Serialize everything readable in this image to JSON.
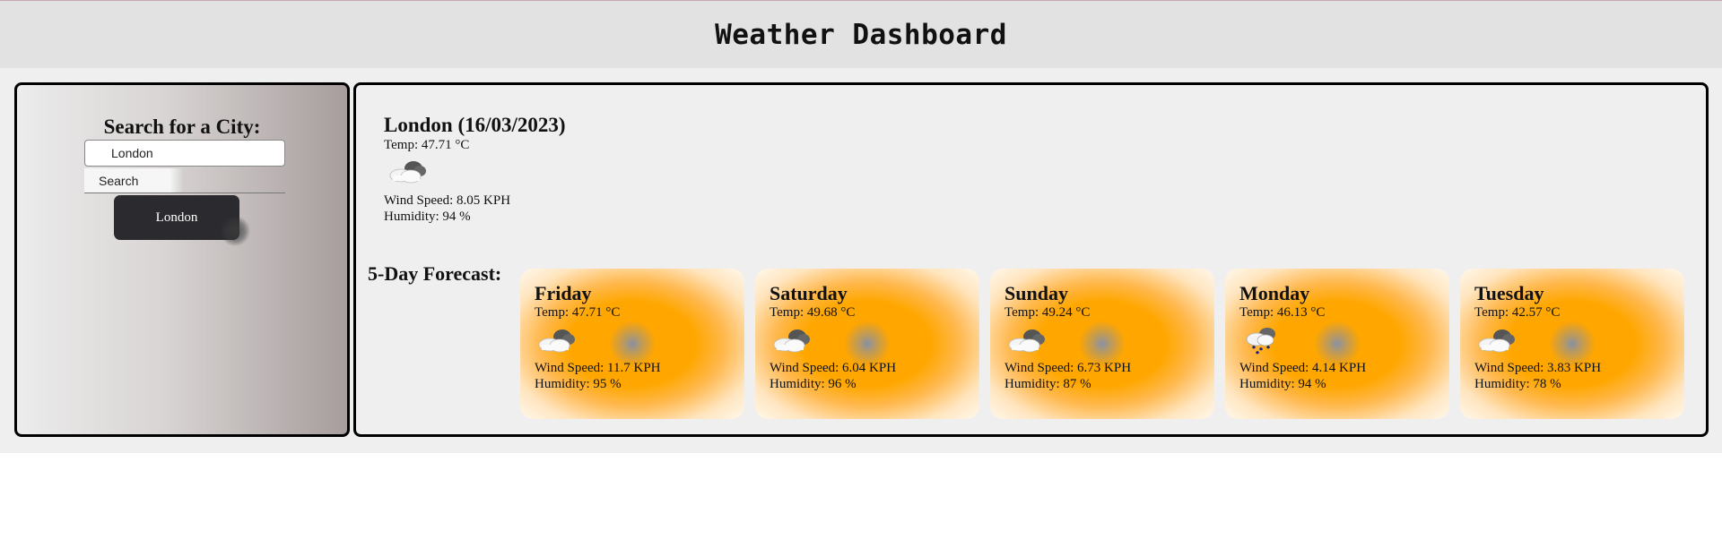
{
  "header": {
    "title": "Weather Dashboard"
  },
  "sidebar": {
    "heading": "Search for a City:",
    "input_value": "London",
    "search_label": "Search",
    "history": [
      "London"
    ]
  },
  "current": {
    "title": "London (16/03/2023)",
    "temp": "Temp: 47.71 °C",
    "icon": "cloudy-icon",
    "wind": "Wind Speed: 8.05 KPH",
    "humidity": "Humidity: 94 %"
  },
  "forecast": {
    "heading": "5-Day Forecast:",
    "days": [
      {
        "day": "Friday",
        "temp": "Temp: 47.71 °C",
        "icon": "cloudy-icon",
        "wind": "Wind Speed: 11.7 KPH",
        "humidity": "Humidity: 95 %"
      },
      {
        "day": "Saturday",
        "temp": "Temp: 49.68 °C",
        "icon": "cloudy-icon",
        "wind": "Wind Speed: 6.04 KPH",
        "humidity": "Humidity: 96 %"
      },
      {
        "day": "Sunday",
        "temp": "Temp: 49.24 °C",
        "icon": "cloudy-icon",
        "wind": "Wind Speed: 6.73 KPH",
        "humidity": "Humidity: 87 %"
      },
      {
        "day": "Monday",
        "temp": "Temp: 46.13 °C",
        "icon": "rain-icon",
        "wind": "Wind Speed: 4.14 KPH",
        "humidity": "Humidity: 94 %"
      },
      {
        "day": "Tuesday",
        "temp": "Temp: 42.57 °C",
        "icon": "cloudy-icon",
        "wind": "Wind Speed: 3.83 KPH",
        "humidity": "Humidity: 78 %"
      }
    ]
  },
  "colors": {
    "header_bg": "#e2e2e2",
    "card_accent": "#ffa500",
    "history_button_bg": "#2a2a2f"
  }
}
